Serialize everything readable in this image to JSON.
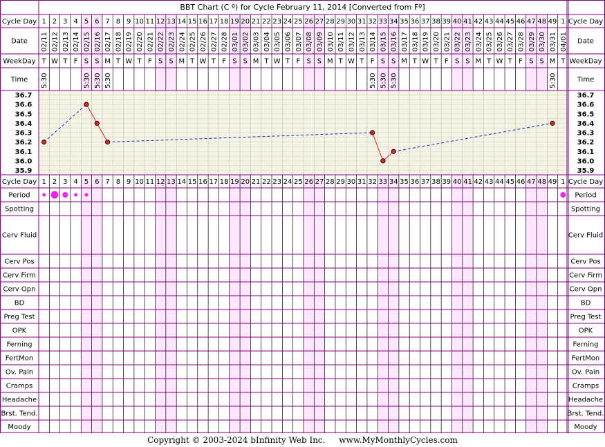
{
  "title": "BBT Chart (C º) for Cycle February 11, 2014  [Converted from Fº]",
  "labels": {
    "cycle_day": "Cycle Day",
    "date": "Date",
    "weekday": "WeekDay",
    "time": "Time",
    "period": "Period",
    "spotting": "Spotting",
    "cerv_fluid": "Cerv Fluid",
    "cerv_pos": "Cerv Pos",
    "cerv_firm": "Cerv Firm",
    "cerv_opn": "Cerv Opn",
    "bd": "BD",
    "preg_test": "Preg Test",
    "opk": "OPK",
    "ferning": "Ferning",
    "fertmon": "FertMon",
    "ov_pain": "Ov. Pain",
    "cramps": "Cramps",
    "headache": "Headache",
    "brst_tend": "Brst. Tend.",
    "moody": "Moody"
  },
  "footer": {
    "copyright": "Copyright © 2003-2024 bInfinity Web Inc.",
    "site": "www.MyMonthlyCycles.com"
  },
  "colors": {
    "border": "#800080",
    "grid": "#bbbbbb",
    "temp_bg": "#f3f3e6",
    "weekend_bg": "#ffe6ff",
    "point": "#dd2222",
    "solid_line": "#dd2222",
    "dashed_line": "#2222cc",
    "period_dot": "#ee22ee"
  },
  "chart_data": {
    "type": "line",
    "cycle_days": [
      "1",
      "2",
      "3",
      "4",
      "5",
      "6",
      "7",
      "8",
      "9",
      "10",
      "11",
      "12",
      "13",
      "14",
      "15",
      "16",
      "17",
      "18",
      "19",
      "20",
      "21",
      "22",
      "23",
      "24",
      "25",
      "26",
      "27",
      "28",
      "29",
      "30",
      "31",
      "32",
      "33",
      "34",
      "35",
      "36",
      "37",
      "38",
      "39",
      "40",
      "41",
      "42",
      "43",
      "44",
      "45",
      "46",
      "47",
      "48",
      "49",
      "1"
    ],
    "dates": [
      "02/11",
      "02/12",
      "02/13",
      "02/14",
      "02/15",
      "02/16",
      "02/17",
      "02/18",
      "02/19",
      "02/20",
      "02/21",
      "02/22",
      "02/23",
      "02/24",
      "02/25",
      "02/26",
      "02/27",
      "02/28",
      "03/01",
      "03/02",
      "03/03",
      "03/04",
      "03/05",
      "03/06",
      "03/07",
      "03/08",
      "03/09",
      "03/10",
      "03/11",
      "03/12",
      "03/13",
      "03/14",
      "03/15",
      "03/16",
      "03/17",
      "03/18",
      "03/19",
      "03/20",
      "03/21",
      "03/22",
      "03/23",
      "03/24",
      "03/25",
      "03/26",
      "03/27",
      "03/28",
      "03/29",
      "03/30",
      "03/31",
      "04/01"
    ],
    "weekdays": [
      "T",
      "W",
      "T",
      "F",
      "S",
      "S",
      "M",
      "T",
      "W",
      "T",
      "F",
      "S",
      "S",
      "M",
      "T",
      "W",
      "T",
      "F",
      "S",
      "S",
      "M",
      "T",
      "W",
      "T",
      "F",
      "S",
      "S",
      "M",
      "T",
      "W",
      "T",
      "F",
      "S",
      "S",
      "M",
      "T",
      "W",
      "T",
      "F",
      "S",
      "S",
      "M",
      "T",
      "W",
      "T",
      "F",
      "S",
      "S",
      "M",
      "T"
    ],
    "times": [
      "5:30",
      "",
      "",
      "",
      "5:30",
      "5:30",
      "5:30",
      "",
      "",
      "",
      "",
      "",
      "",
      "",
      "",
      "",
      "",
      "",
      "",
      "",
      "",
      "",
      "",
      "",
      "",
      "",
      "",
      "",
      "",
      "",
      "",
      "5:30",
      "5:30",
      "5:30",
      "",
      "",
      "",
      "",
      "",
      "",
      "",
      "",
      "",
      "",
      "",
      "",
      "",
      "",
      "5:30",
      ""
    ],
    "temperatures": [
      36.2,
      null,
      null,
      null,
      36.6,
      36.4,
      36.2,
      null,
      null,
      null,
      null,
      null,
      null,
      null,
      null,
      null,
      null,
      null,
      null,
      null,
      null,
      null,
      null,
      null,
      null,
      null,
      null,
      null,
      null,
      null,
      null,
      36.3,
      36.0,
      36.1,
      null,
      null,
      null,
      null,
      null,
      null,
      null,
      null,
      null,
      null,
      null,
      null,
      null,
      null,
      36.4,
      null
    ],
    "y_ticks": [
      "36.7",
      "36.6",
      "36.5",
      "36.4",
      "36.3",
      "36.2",
      "36.1",
      "36.0",
      "35.9"
    ],
    "ylim": [
      35.9,
      36.7
    ],
    "period": [
      1,
      3,
      2,
      1,
      1,
      0,
      0,
      0,
      0,
      0,
      0,
      0,
      0,
      0,
      0,
      0,
      0,
      0,
      0,
      0,
      0,
      0,
      0,
      0,
      0,
      0,
      0,
      0,
      0,
      0,
      0,
      0,
      0,
      0,
      0,
      0,
      0,
      0,
      0,
      0,
      0,
      0,
      0,
      0,
      0,
      0,
      0,
      0,
      0,
      2
    ],
    "grid": true
  }
}
